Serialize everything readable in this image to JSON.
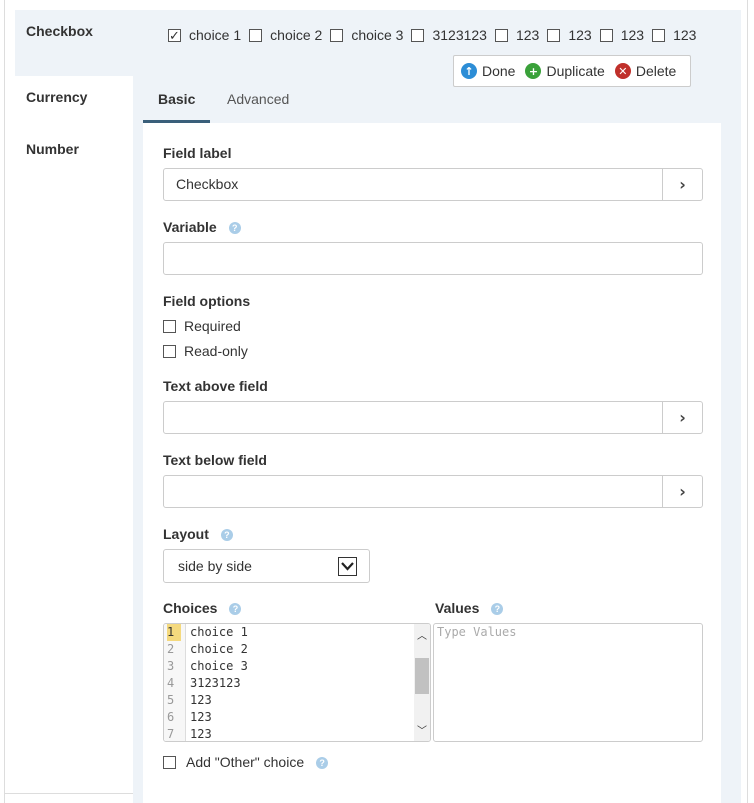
{
  "sidebar": {
    "items": [
      {
        "label": "Checkbox"
      },
      {
        "label": "Currency"
      },
      {
        "label": "Number"
      }
    ]
  },
  "preview": {
    "choices": [
      {
        "label": "choice 1",
        "checked": true
      },
      {
        "label": "choice 2",
        "checked": false
      },
      {
        "label": "choice 3",
        "checked": false
      },
      {
        "label": "3123123",
        "checked": false
      },
      {
        "label": "123",
        "checked": false
      },
      {
        "label": "123",
        "checked": false
      },
      {
        "label": "123",
        "checked": false
      },
      {
        "label": "123",
        "checked": false
      }
    ]
  },
  "actions": {
    "done": "Done",
    "duplicate": "Duplicate",
    "delete": "Delete",
    "colors": {
      "done": "#2c8dd6",
      "duplicate": "#3aa13a",
      "delete": "#c0302b"
    }
  },
  "tabs": {
    "basic": "Basic",
    "advanced": "Advanced"
  },
  "form": {
    "field_label": {
      "label": "Field label",
      "value": "Checkbox"
    },
    "variable": {
      "label": "Variable",
      "value": ""
    },
    "field_options": {
      "label": "Field options",
      "required": "Required",
      "readonly": "Read-only"
    },
    "text_above": {
      "label": "Text above field",
      "value": ""
    },
    "text_below": {
      "label": "Text below field",
      "value": ""
    },
    "layout": {
      "label": "Layout",
      "selected": "side by side"
    },
    "choices": {
      "label": "Choices",
      "lines": [
        "choice 1",
        "choice 2",
        "choice 3",
        "3123123",
        "123",
        "123",
        "123"
      ]
    },
    "values": {
      "label": "Values",
      "placeholder": "Type Values"
    },
    "add_other": "Add \"Other\" choice"
  }
}
